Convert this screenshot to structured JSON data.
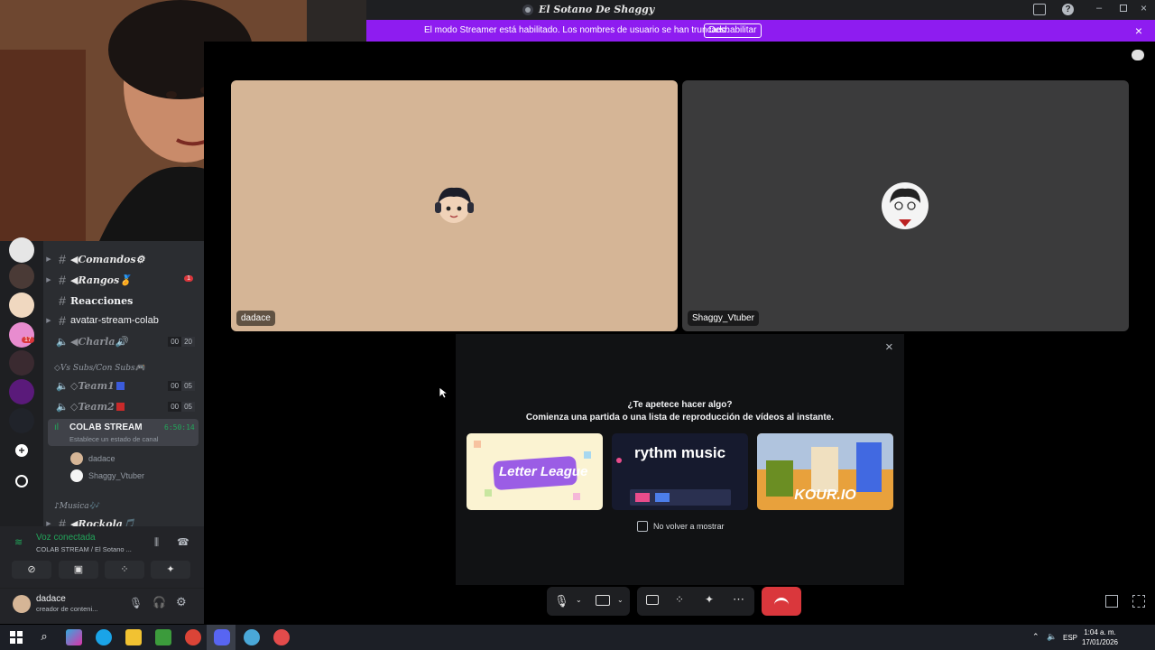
{
  "window": {
    "title": "El Sotano De Shaggy"
  },
  "streamer_banner": {
    "text": "El modo Streamer está habilitado. Los nombres de usuario se han truncado.",
    "button": "Deshabilitar"
  },
  "channels": [
    {
      "name": "◀Comandos⚙",
      "type": "text",
      "style": "fancy"
    },
    {
      "name": "◀Rangos🏅",
      "type": "text",
      "style": "fancy",
      "badge": "1"
    },
    {
      "name": "Reacciones",
      "type": "text",
      "style": "bold"
    },
    {
      "name": "avatar-stream-colab",
      "type": "text",
      "style": "plain"
    },
    {
      "name": "◀Charla🔊",
      "type": "voice",
      "count_a": "00",
      "count_b": "20"
    }
  ],
  "category_subs": "◇Vs Subs/Con Subs🎮",
  "team_channels": [
    {
      "name": "◇Team1",
      "count_a": "00",
      "count_b": "05",
      "color": "#3b5bdb"
    },
    {
      "name": "◇Team2",
      "count_a": "00",
      "count_b": "05",
      "color": "#c92a2a"
    }
  ],
  "colab": {
    "name": "COLAB STREAM",
    "time": "6:50:14",
    "status": "Establece un estado de canal"
  },
  "voice_members": [
    "dadace",
    "Shaggy_Vtuber"
  ],
  "category_music": "♪Musica🎶",
  "music_channel": "◀Rockola🎵",
  "voice_panel": {
    "status": "Voz conectada",
    "location": "COLAB STREAM / El Sotano ..."
  },
  "user": {
    "name": "dadace",
    "status": "creador de conteni..."
  },
  "tiles": [
    {
      "label": "dadace"
    },
    {
      "label": "Shaggy_Vtuber"
    }
  ],
  "activity": {
    "title": "¿Te apetece hacer algo?",
    "subtitle": "Comienza una partida o una lista de reproducción de vídeos al instante.",
    "cards": [
      {
        "name": "Letter League"
      },
      {
        "name": "rythm music"
      },
      {
        "name": "KOUR.IO"
      }
    ],
    "checkbox_label": "No volver a mostrar"
  },
  "taskbar": {
    "lang": "ESP",
    "time": "1:04 a. m.",
    "date": "17/01/2026"
  },
  "colors": {
    "accent": "#8e1cf0",
    "hangup": "#da373c",
    "online": "#23a55a"
  }
}
